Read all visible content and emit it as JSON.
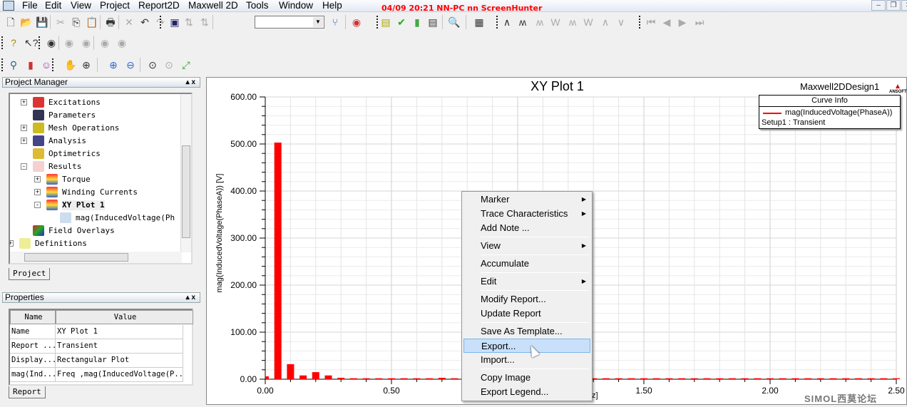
{
  "menubar": {
    "items": [
      "File",
      "Edit",
      "View",
      "Project",
      "Report2D",
      "Maxwell 2D",
      "Tools",
      "Window",
      "Help"
    ],
    "recorder_overlay": "04/09  20:21  NN-PC  nn  ScreenHunter"
  },
  "window_controls": {
    "minimize": "–",
    "restore": "❐",
    "close": "✕"
  },
  "toolbars": {
    "combo_value": ""
  },
  "project_manager": {
    "title": "Project Manager",
    "pin": "▴ x",
    "tab": "Project",
    "nodes": [
      {
        "label": "Excitations",
        "expander": "+",
        "icon": "excitations-icon"
      },
      {
        "label": "Parameters",
        "expander": "",
        "icon": "parameters-icon"
      },
      {
        "label": "Mesh Operations",
        "expander": "+",
        "icon": "mesh-operations-icon"
      },
      {
        "label": "Analysis",
        "expander": "+",
        "icon": "analysis-icon"
      },
      {
        "label": "Optimetrics",
        "expander": "",
        "icon": "optimetrics-icon"
      },
      {
        "label": "Results",
        "expander": "−",
        "icon": "results-icon"
      },
      {
        "label": "Torque",
        "expander": "+",
        "icon": "report-icon"
      },
      {
        "label": "Winding Currents",
        "expander": "+",
        "icon": "report-icon"
      },
      {
        "label": "XY Plot 1",
        "expander": "−",
        "icon": "report-icon",
        "selected": true
      },
      {
        "label": "mag(InducedVoltage(Ph",
        "expander": "",
        "icon": "trace-icon"
      },
      {
        "label": "Field Overlays",
        "expander": "",
        "icon": "field-overlays-icon"
      },
      {
        "label": "Definitions",
        "expander": "+",
        "icon": "folder-icon"
      }
    ]
  },
  "properties": {
    "title": "Properties",
    "pin": "▴ x",
    "tab": "Report",
    "headers": [
      "Name",
      "Value"
    ],
    "rows": [
      [
        "Name",
        "XY Plot 1"
      ],
      [
        "Report ...",
        "Transient"
      ],
      [
        "Display...",
        "Rectangular Plot"
      ],
      [
        "mag(Ind...",
        "Freq ,mag(InducedVoltage(P..."
      ]
    ]
  },
  "plot": {
    "design_name": "Maxwell2DDesign1",
    "logo": "ANSOFT",
    "legend": {
      "title": "Curve Info",
      "entry": "mag(InducedVoltage(PhaseA))",
      "setup": "Setup1 : Transient"
    }
  },
  "chart_data": {
    "type": "bar",
    "title": "XY Plot 1",
    "xlabel": "Hz]",
    "ylabel": "mag(InducedVoltage(PhaseA)) [V]",
    "xlim": [
      0,
      2.5
    ],
    "ylim": [
      0,
      600
    ],
    "grid": true,
    "legend_position": "top-right",
    "xticks": [
      "0.00",
      "0.50",
      "1.00",
      "1.50",
      "2.00",
      "2.50"
    ],
    "yticks": [
      "0.00",
      "100.00",
      "200.00",
      "300.00",
      "400.00",
      "500.00",
      "600.00"
    ],
    "series": [
      {
        "name": "mag(InducedVoltage(PhaseA))",
        "color": "#ff0000",
        "x": [
          0,
          0.05,
          0.1,
          0.15,
          0.2,
          0.25,
          0.3,
          0.35,
          0.4,
          0.45,
          0.5,
          0.55,
          0.6,
          0.65,
          0.7,
          0.75,
          0.8,
          0.85,
          0.9,
          0.95,
          1.0,
          1.05,
          1.1,
          1.15,
          1.2,
          1.25,
          1.3,
          1.35,
          1.4,
          1.45,
          1.5,
          1.55,
          1.6,
          1.65,
          1.7,
          1.75,
          1.8,
          1.85,
          1.9,
          1.95,
          2.0,
          2.05,
          2.1,
          2.15,
          2.2,
          2.25,
          2.3,
          2.35,
          2.4,
          2.45,
          2.5
        ],
        "values": [
          6,
          503,
          32,
          8,
          15,
          8,
          3,
          2,
          2,
          2,
          2,
          2,
          2,
          2,
          3,
          2,
          2,
          2,
          2,
          2,
          2,
          2,
          2,
          2,
          2,
          2,
          2,
          2,
          2,
          2,
          2,
          2,
          2,
          2,
          2,
          2,
          2,
          2,
          2,
          2,
          2,
          2,
          2,
          2,
          2,
          2,
          2,
          2,
          2,
          2,
          2
        ]
      }
    ]
  },
  "context_menu": {
    "items": [
      {
        "label": "Marker",
        "submenu": true
      },
      {
        "label": "Trace Characteristics",
        "submenu": true
      },
      {
        "label": "Add Note ..."
      },
      {
        "sep": true
      },
      {
        "label": "View",
        "submenu": true
      },
      {
        "sep": true
      },
      {
        "label": "Accumulate"
      },
      {
        "sep": true
      },
      {
        "label": "Edit",
        "submenu": true
      },
      {
        "sep": true
      },
      {
        "label": "Modify Report..."
      },
      {
        "label": "Update Report"
      },
      {
        "sep": true
      },
      {
        "label": "Save As Template..."
      },
      {
        "label": "Export...",
        "highlighted": true
      },
      {
        "label": "Import..."
      },
      {
        "sep": true
      },
      {
        "label": "Copy Image"
      },
      {
        "label": "Export Legend..."
      }
    ]
  },
  "watermark": "SIMOL西莫论坛"
}
